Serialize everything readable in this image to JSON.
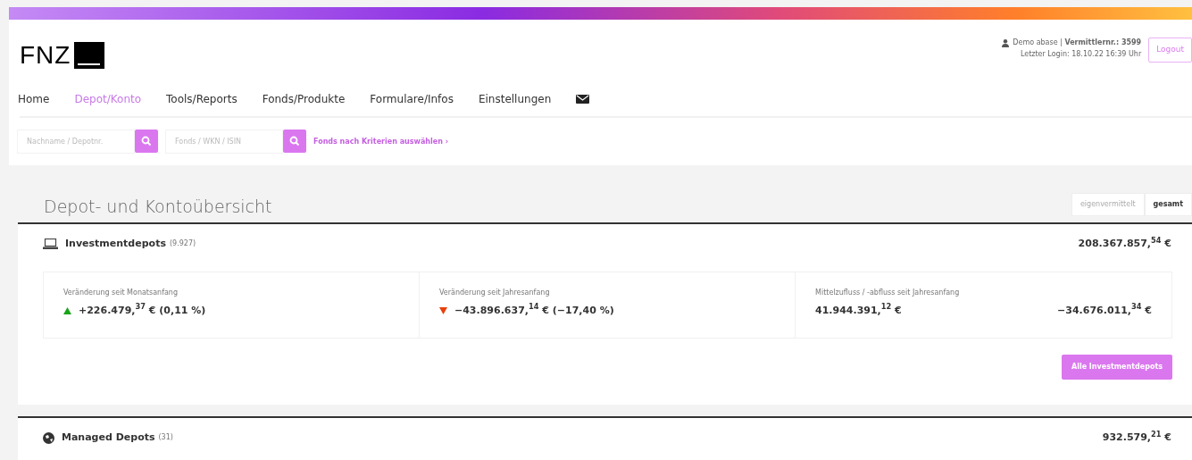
{
  "logo": {
    "text": "FNZ"
  },
  "user": {
    "name": "Demo abase",
    "separator": "|",
    "agent": "Vermittlernr.: 3599",
    "last_login": "Letzter Login: 18.10.22 16:39 Uhr"
  },
  "logout_button": "Logout",
  "nav": [
    {
      "label": "Home",
      "selected": false
    },
    {
      "label": "Depot/Konto",
      "selected": true
    },
    {
      "label": "Tools/Reports",
      "selected": false
    },
    {
      "label": "Fonds/Produkte",
      "selected": false
    },
    {
      "label": "Formulare/Infos",
      "selected": false
    },
    {
      "label": "Einstellungen",
      "selected": false
    }
  ],
  "search": [
    {
      "placeholder": "Nachname / Depotnr."
    },
    {
      "placeholder": "Fonds / WKN / ISIN"
    }
  ],
  "criteria_link": "Fonds nach Kriterien auswählen ›",
  "page_title": "Depot- und Kontoübersicht",
  "filter": [
    {
      "label": "eigenvermittelt",
      "selected": false
    },
    {
      "label": "gesamt",
      "selected": true
    }
  ],
  "sections": [
    {
      "kind": "laptop",
      "title": "Investmentdepots",
      "count": "(9.927)",
      "total": "208.367.857,$^{54}$ €",
      "stats": [
        {
          "label": "Veränderung seit Monatsanfang",
          "kind": "rise",
          "values": [
            "+226.479,$^{37}$ € (0,11 %)"
          ]
        },
        {
          "label": "Veränderung seit Jahresanfang",
          "kind": "fall",
          "values": [
            "−43.896.637,$^{14}$ € (−17,40 %)"
          ]
        },
        {
          "label": "Mittelzufluss / -abfluss seit Jahresanfang",
          "kind": "plain",
          "values": [
            "41.944.391,$^{12}$ €",
            "−34.676.011,$^{34}$ €"
          ]
        }
      ],
      "button": "Alle Investmentdepots"
    },
    {
      "kind": "globe",
      "title": "Managed Depots",
      "count": "(31)",
      "total": "932.579,$^{21}$ €"
    }
  ]
}
